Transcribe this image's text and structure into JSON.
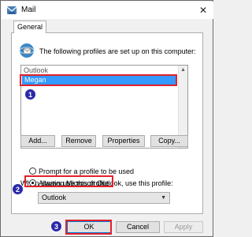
{
  "window": {
    "title": "Mail",
    "close_icon": "close-icon"
  },
  "tabs": [
    {
      "label": "General"
    }
  ],
  "intro_text": "The following profiles are set up on this computer:",
  "profiles": {
    "header": "Outlook",
    "items": [
      "Megan"
    ],
    "selected": "Megan"
  },
  "profile_buttons": {
    "add": "Add...",
    "remove": "Remove",
    "properties": "Properties",
    "copy": "Copy..."
  },
  "startup": {
    "label": "When starting Microsoft Outlook, use this profile:",
    "options": [
      "Prompt for a profile to be used",
      "Always use this profile"
    ],
    "selected_option": "Always use this profile",
    "profile_select": "Outlook"
  },
  "dialog_buttons": {
    "ok": "OK",
    "cancel": "Cancel",
    "apply": "Apply"
  },
  "annotations": [
    "1",
    "2",
    "3"
  ],
  "colors": {
    "highlight": "#e3212a",
    "marker": "#2b2aa8",
    "selection": "#3399ff"
  }
}
